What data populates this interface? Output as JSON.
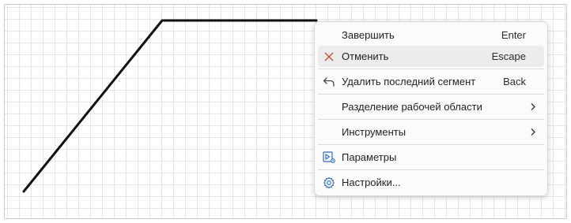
{
  "colors": {
    "line": "#111111",
    "cancel_icon": "#d24a3a",
    "settings_icon": "#2f66c9",
    "params_icon": "#2f66c9"
  },
  "drawing": {
    "segments_count": 3
  },
  "context_menu": {
    "items": [
      {
        "label": "Завершить",
        "shortcut": "Enter",
        "icon": ""
      },
      {
        "label": "Отменить",
        "shortcut": "Escape",
        "icon": "close-icon"
      },
      {
        "label": "Удалить последний сегмент",
        "shortcut": "Back",
        "icon": "undo-arrow-icon"
      },
      {
        "label": "Разделение рабочей области",
        "icon": "",
        "submenu": true
      },
      {
        "label": "Инструменты",
        "icon": "",
        "submenu": true
      },
      {
        "label": "Параметры",
        "icon": "parameters-icon"
      },
      {
        "label": "Настройки...",
        "icon": "gear-icon"
      }
    ]
  }
}
